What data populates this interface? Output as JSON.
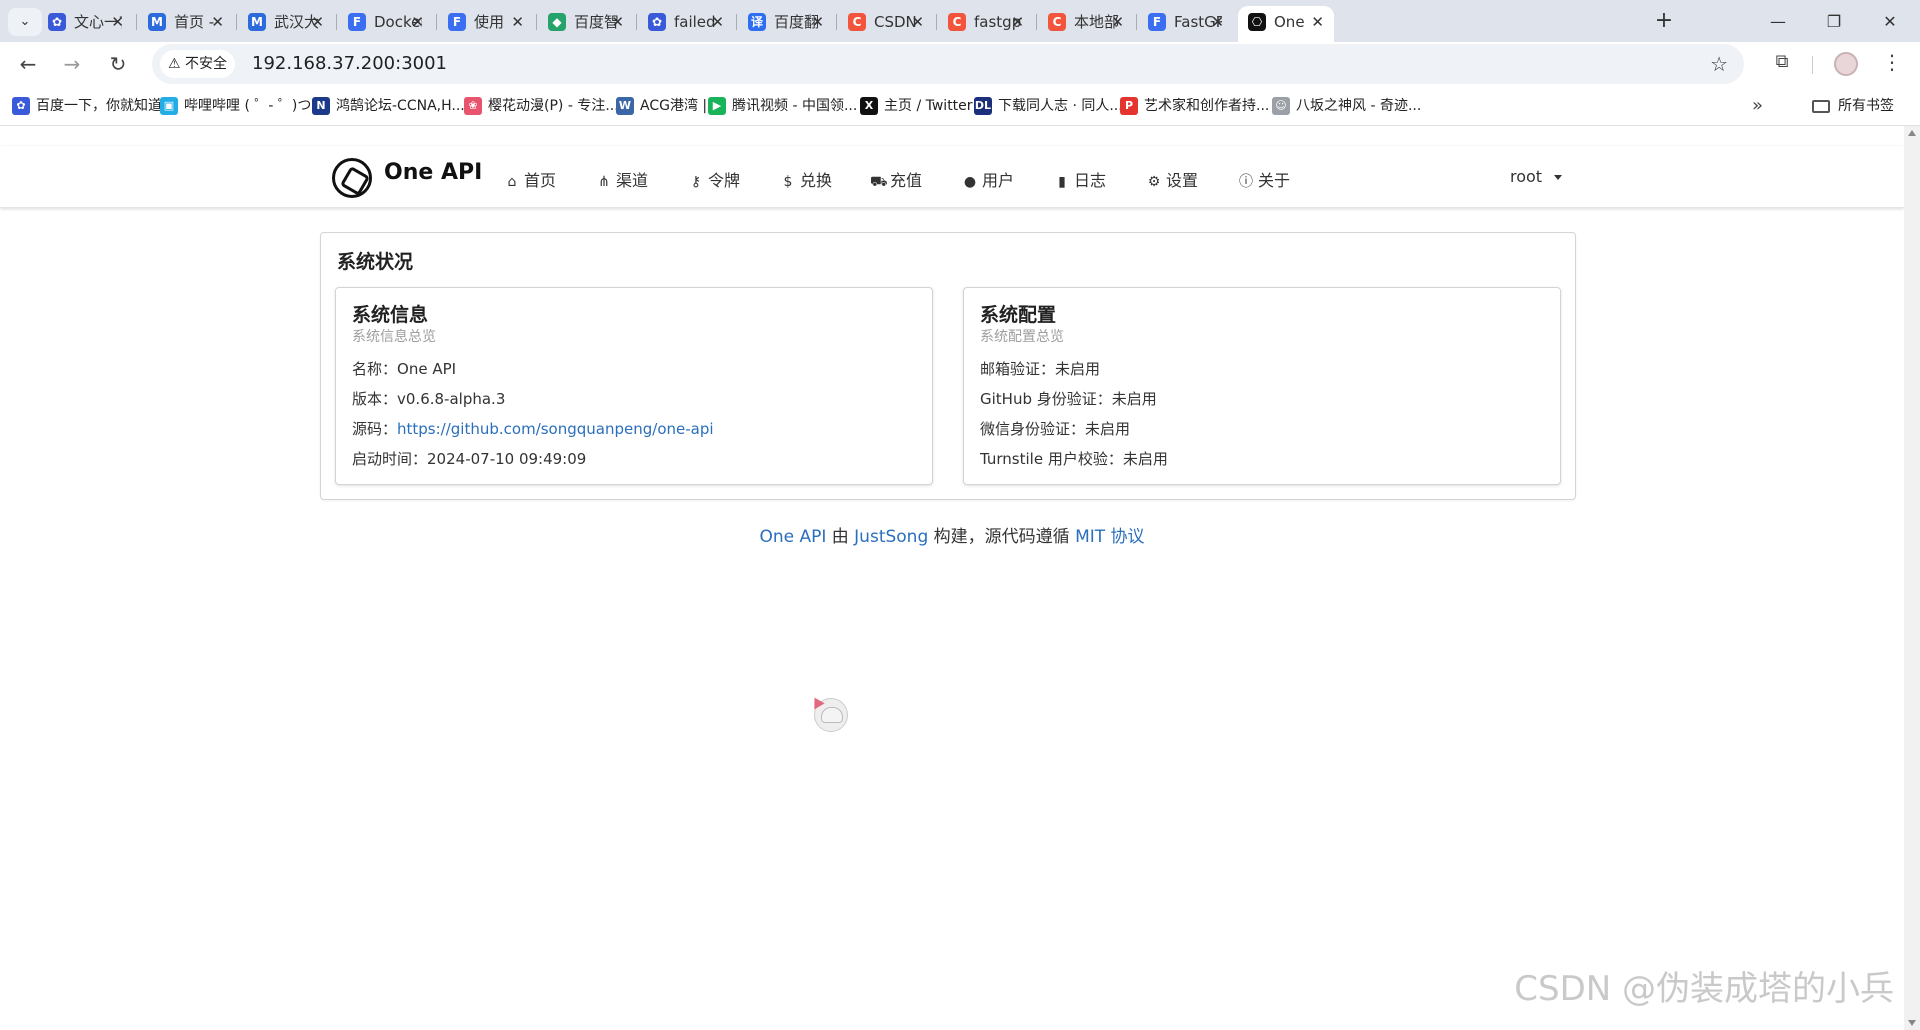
{
  "browser": {
    "tabs": [
      {
        "title": "文心一言",
        "favicon_color": "#3a5bd9",
        "favicon_glyph": "✿",
        "favicon_icon": "paw-icon"
      },
      {
        "title": "首页 - ",
        "favicon_color": "#2d6bdc",
        "favicon_glyph": "M",
        "favicon_icon": "m-logo-icon"
      },
      {
        "title": "武汉大",
        "favicon_color": "#2d6bdc",
        "favicon_glyph": "M",
        "favicon_icon": "m-logo-icon"
      },
      {
        "title": "Docker",
        "favicon_color": "#3b6ef0",
        "favicon_glyph": "F",
        "favicon_icon": "f-logo-icon"
      },
      {
        "title": "使用",
        "favicon_color": "#3b6ef0",
        "favicon_glyph": "F",
        "favicon_icon": "f-logo-icon"
      },
      {
        "title": "百度智",
        "favicon_color": "#26a26b",
        "favicon_glyph": "◆",
        "favicon_icon": "hexagon-icon"
      },
      {
        "title": "failed",
        "favicon_color": "#3a5bd9",
        "favicon_glyph": "✿",
        "favicon_icon": "paw-icon"
      },
      {
        "title": "百度翻",
        "favicon_color": "#2e6ff2",
        "favicon_glyph": "译",
        "favicon_icon": "translate-icon"
      },
      {
        "title": "CSDN",
        "favicon_color": "#f2553c",
        "favicon_glyph": "C",
        "favicon_icon": "csdn-icon"
      },
      {
        "title": "fastgpt",
        "favicon_color": "#f2553c",
        "favicon_glyph": "C",
        "favicon_icon": "csdn-icon"
      },
      {
        "title": "本地部",
        "favicon_color": "#f2553c",
        "favicon_glyph": "C",
        "favicon_icon": "csdn-icon"
      },
      {
        "title": "FastGPT",
        "favicon_color": "#3b6ef0",
        "favicon_glyph": "F",
        "favicon_icon": "f-logo-icon"
      },
      {
        "title": "One",
        "favicon_color": "#111111",
        "favicon_glyph": "⎔",
        "favicon_icon": "openai-icon",
        "active": true
      }
    ],
    "security_label": "不安全",
    "url": "192.168.37.200:3001",
    "bookmarks": [
      {
        "label": "百度一下，你就知道",
        "color": "#3a5bd9",
        "glyph": "✿",
        "icon": "paw-icon"
      },
      {
        "label": "哔哩哔哩 ( ゜- ゜)つ...",
        "color": "#23ade5",
        "glyph": "▣",
        "icon": "bilibili-icon"
      },
      {
        "label": "鸿鹄论坛-CCNA,H...",
        "color": "#1b3b8a",
        "glyph": "N",
        "icon": "n-logo-icon"
      },
      {
        "label": "樱花动漫(P) - 专注...",
        "color": "#e8546e",
        "glyph": "❀",
        "icon": "sakura-icon"
      },
      {
        "label": "ACG港湾 |",
        "color": "#3b67a7",
        "glyph": "W",
        "icon": "wordpress-icon"
      },
      {
        "label": "腾讯视频 - 中国领...",
        "color": "#19b35a",
        "glyph": "▶",
        "icon": "play-icon"
      },
      {
        "label": "主页 / Twitter",
        "color": "#111111",
        "glyph": "X",
        "icon": "x-logo-icon"
      },
      {
        "label": "下载同人志 · 同人...",
        "color": "#1b2f7a",
        "glyph": "DL",
        "icon": "dl-logo-icon"
      },
      {
        "label": "艺术家和创作者持...",
        "color": "#e3342f",
        "glyph": "P",
        "icon": "patreon-icon"
      },
      {
        "label": "八坂之神风 - 奇迹...",
        "color": "#9aa0a6",
        "glyph": "☺",
        "icon": "avatar-icon"
      }
    ],
    "all_bookmarks_label": "所有书签"
  },
  "app": {
    "brand": "One API",
    "menu": [
      {
        "label": "首页",
        "glyph": "⌂",
        "icon": "home-icon"
      },
      {
        "label": "渠道",
        "glyph": "⋔",
        "icon": "sitemap-icon"
      },
      {
        "label": "令牌",
        "glyph": "⚷",
        "icon": "key-icon"
      },
      {
        "label": "兑换",
        "glyph": "$",
        "icon": "dollar-icon"
      },
      {
        "label": "充值",
        "glyph": "⛟",
        "icon": "cart-icon"
      },
      {
        "label": "用户",
        "glyph": "●",
        "icon": "user-icon"
      },
      {
        "label": "日志",
        "glyph": "▮",
        "icon": "book-icon"
      },
      {
        "label": "设置",
        "glyph": "⚙",
        "icon": "gear-icon"
      },
      {
        "label": "关于",
        "glyph": "ⓘ",
        "icon": "info-icon"
      }
    ],
    "user": "root"
  },
  "status": {
    "title": "系统状况",
    "info": {
      "title": "系统信息",
      "subtitle": "系统信息总览",
      "name_label": "名称：",
      "name": "One API",
      "version_label": "版本：",
      "version": "v0.6.8-alpha.3",
      "source_label": "源码：",
      "source": "https://github.com/songquanpeng/one-api",
      "start_label": "启动时间：",
      "start": "2024-07-10 09:49:09"
    },
    "config": {
      "title": "系统配置",
      "subtitle": "系统配置总览",
      "rows": [
        {
          "label": "邮箱验证：",
          "value": "未启用"
        },
        {
          "label": "GitHub 身份验证：",
          "value": "未启用"
        },
        {
          "label": "微信身份验证：",
          "value": "未启用"
        },
        {
          "label": "Turnstile 用户校验：",
          "value": "未启用"
        }
      ]
    }
  },
  "footer": {
    "project": "One API",
    "by": " 由 ",
    "author": "JustSong",
    "built": " 构建，源代码遵循 ",
    "license": "MIT 协议"
  },
  "watermark": "CSDN @伪装成塔的小兵"
}
